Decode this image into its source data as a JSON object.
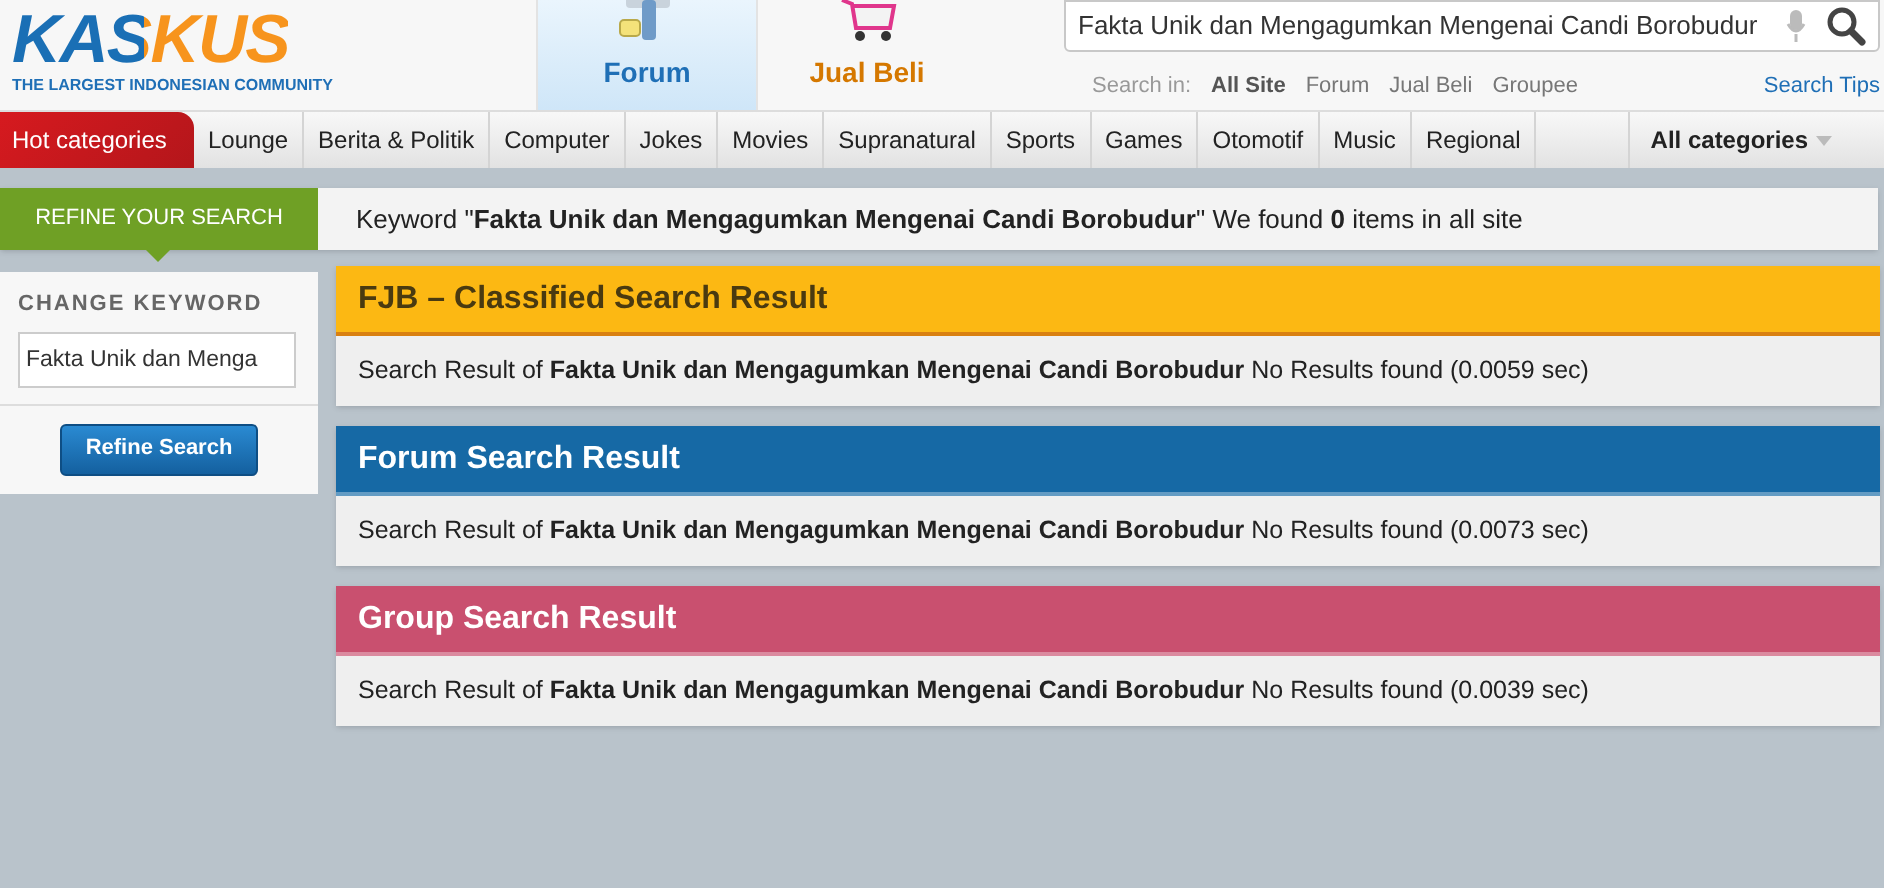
{
  "logo": {
    "text": "KASKUS",
    "tagline": "THE LARGEST INDONESIAN COMMUNITY"
  },
  "header_tabs": [
    {
      "label": "Forum",
      "kind": "forum",
      "selected": true
    },
    {
      "label": "Jual Beli",
      "kind": "cart",
      "selected": false
    }
  ],
  "search": {
    "value": "Fakta Unik dan Mengagumkan Mengenai Candi Borobudur",
    "scope_label": "Search in:",
    "scopes": [
      {
        "label": "All Site",
        "selected": true
      },
      {
        "label": "Forum",
        "selected": false
      },
      {
        "label": "Jual Beli",
        "selected": false
      },
      {
        "label": "Groupee",
        "selected": false
      }
    ],
    "tips": "Search Tips"
  },
  "nav": {
    "items": [
      {
        "label": "Hot categories",
        "selected": true
      },
      {
        "label": "Lounge",
        "selected": false
      },
      {
        "label": "Berita & Politik",
        "selected": false
      },
      {
        "label": "Computer",
        "selected": false
      },
      {
        "label": "Jokes",
        "selected": false
      },
      {
        "label": "Movies",
        "selected": false
      },
      {
        "label": "Supranatural",
        "selected": false
      },
      {
        "label": "Sports",
        "selected": false
      },
      {
        "label": "Games",
        "selected": false
      },
      {
        "label": "Otomotif",
        "selected": false
      },
      {
        "label": "Music",
        "selected": false
      },
      {
        "label": "Regional",
        "selected": false
      }
    ],
    "all": "All categories"
  },
  "refine": {
    "title": "REFINE YOUR SEARCH",
    "summary": "Keyword \"**Fakta Unik dan Mengagumkan Mengenai Candi Borobudur**\" We found **0** items in all site"
  },
  "sidebar": {
    "heading": "CHANGE KEYWORD",
    "keyword": "Fakta Unik dan Menga",
    "button": "Refine Search"
  },
  "results": [
    {
      "title": "FJB – Classified Search Result",
      "color": "#fcb813",
      "text": "Search Result of **Fakta Unik dan Mengagumkan Mengenai Candi Borobudur**  No Results found (0.0059 sec)"
    },
    {
      "title": "Forum Search Result",
      "color": "#1669a5",
      "text": "Search Result of **Fakta Unik dan Mengagumkan Mengenai Candi Borobudur** No Results found (0.0073 sec)"
    },
    {
      "title": "Group Search Result",
      "color": "#c9506f",
      "text": "Search Result of **Fakta Unik dan Mengagumkan Mengenai Candi Borobudur** No Results found (0.0039 sec)"
    }
  ]
}
